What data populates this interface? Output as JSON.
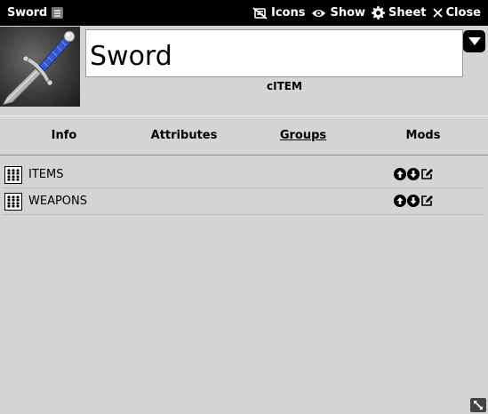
{
  "window": {
    "title": "Sword",
    "controls": [
      {
        "label": "Icons",
        "icon": "icons-off-icon"
      },
      {
        "label": "Show",
        "icon": "eye-icon"
      },
      {
        "label": "Sheet",
        "icon": "gear-icon"
      },
      {
        "label": "Close",
        "icon": "close-icon"
      }
    ]
  },
  "item": {
    "name": "Sword",
    "type": "cITEM",
    "image": "sword-portrait"
  },
  "tabs": [
    {
      "label": "Info",
      "active": false
    },
    {
      "label": "Attributes",
      "active": false
    },
    {
      "label": "Groups",
      "active": true
    },
    {
      "label": "Mods",
      "active": false
    }
  ],
  "groups": [
    {
      "label": "ITEMS",
      "icon": "group-icon"
    },
    {
      "label": "WEAPONS",
      "icon": "group-icon"
    }
  ],
  "colors": {
    "background": "#d4d4d4",
    "header": "#000000",
    "sword_grip": "#3557c9"
  }
}
